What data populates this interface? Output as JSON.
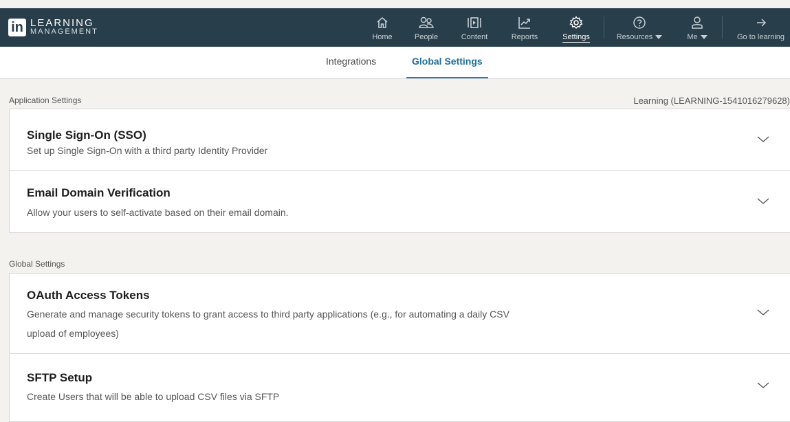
{
  "brand": {
    "line1": "LEARNING",
    "line2": "MANAGEMENT",
    "logo": "in"
  },
  "nav": {
    "home": "Home",
    "people": "People",
    "content": "Content",
    "reports": "Reports",
    "settings": "Settings",
    "resources": "Resources",
    "me": "Me",
    "go": "Go to learning"
  },
  "tabs": {
    "integrations": "Integrations",
    "global_settings": "Global Settings"
  },
  "app_settings": {
    "label": "Application Settings",
    "app_id": "Learning (LEARNING-1541016279628)",
    "cards": [
      {
        "title": "Single Sign-On (SSO)",
        "desc": "Set up Single Sign-On with a third party Identity Provider"
      },
      {
        "title": "Email Domain Verification",
        "desc": "Allow your users to self-activate based on their email domain."
      }
    ]
  },
  "global_settings": {
    "label": "Global Settings",
    "cards": [
      {
        "title": "OAuth Access Tokens",
        "desc": "Generate and manage security tokens to grant access to third party applications (e.g., for automating a daily CSV upload of employees)"
      },
      {
        "title": "SFTP Setup",
        "desc": "Create Users that will be able to upload CSV files via SFTP"
      }
    ]
  },
  "colors": {
    "topbar": "#283e4a",
    "accent": "#1f6e9c",
    "background": "#f3f2ef"
  }
}
